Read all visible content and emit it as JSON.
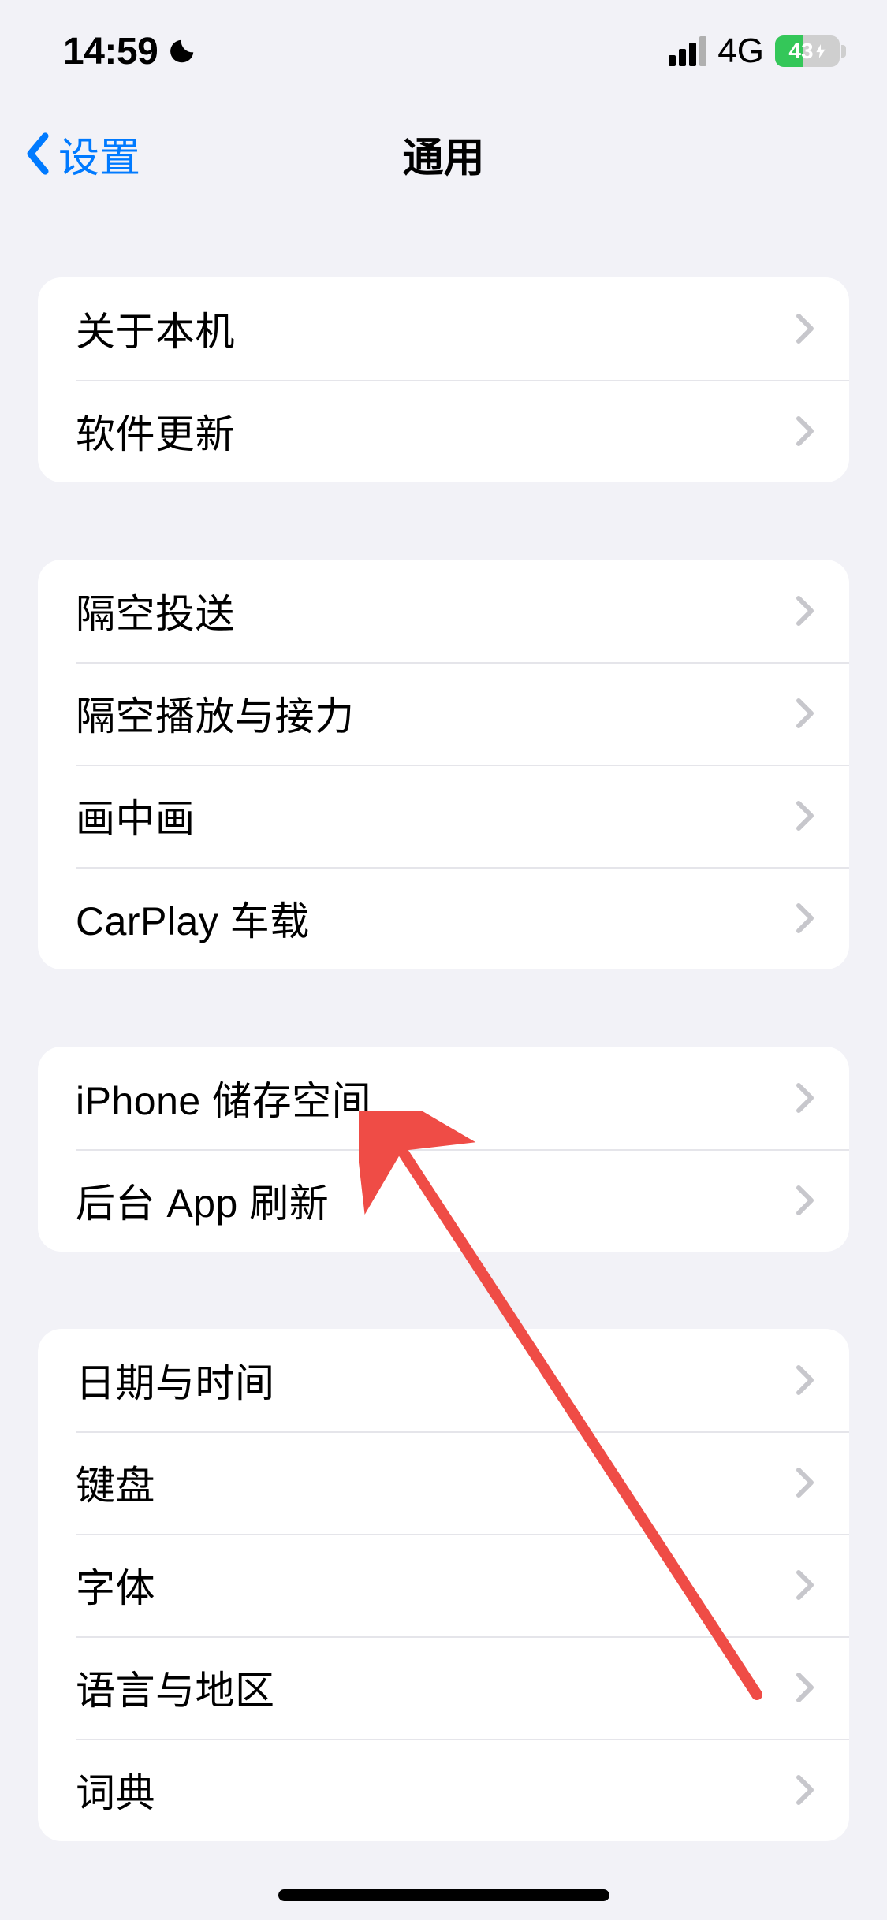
{
  "status_bar": {
    "time": "14:59",
    "network": "4G",
    "battery_level": "43"
  },
  "nav": {
    "back_label": "设置",
    "title": "通用"
  },
  "groups": [
    {
      "items": [
        {
          "label": "关于本机"
        },
        {
          "label": "软件更新"
        }
      ]
    },
    {
      "items": [
        {
          "label": "隔空投送"
        },
        {
          "label": "隔空播放与接力"
        },
        {
          "label": "画中画"
        },
        {
          "label": "CarPlay 车载"
        }
      ]
    },
    {
      "items": [
        {
          "label": "iPhone 储存空间"
        },
        {
          "label": "后台 App 刷新"
        }
      ]
    },
    {
      "items": [
        {
          "label": "日期与时间"
        },
        {
          "label": "键盘"
        },
        {
          "label": "字体"
        },
        {
          "label": "语言与地区"
        },
        {
          "label": "词典"
        }
      ]
    }
  ]
}
